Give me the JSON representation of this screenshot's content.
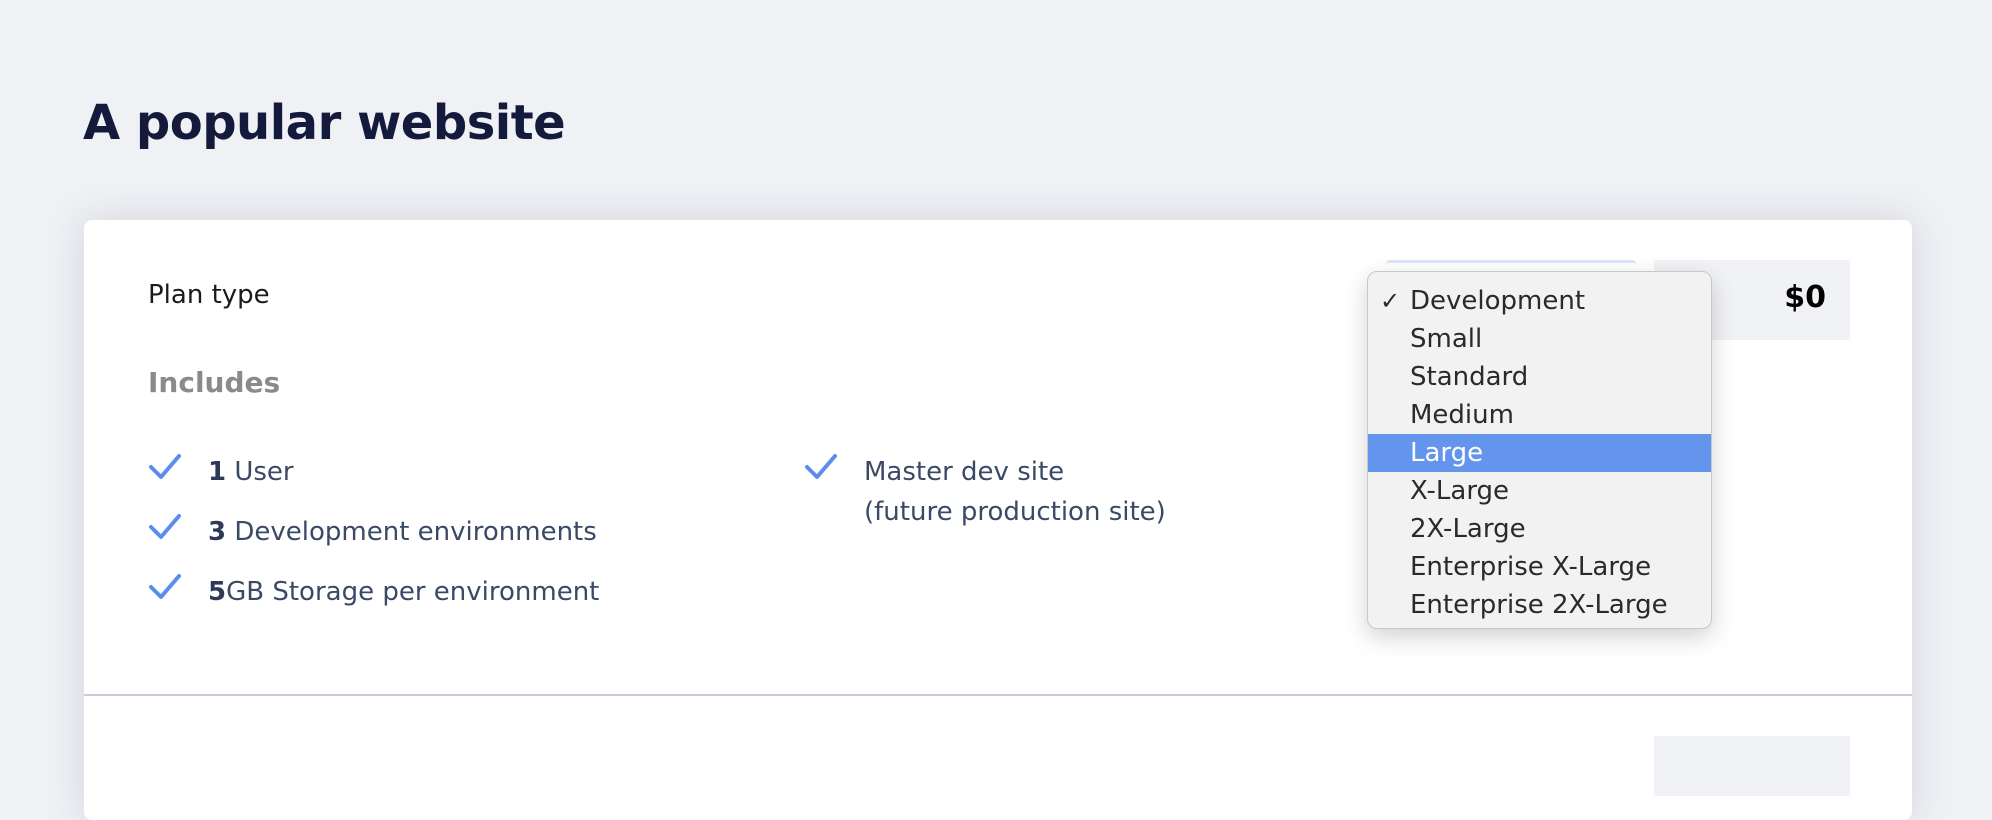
{
  "page": {
    "title": "A popular website"
  },
  "plan": {
    "label": "Plan type",
    "price": "$0"
  },
  "includes": {
    "heading": "Includes",
    "column1": [
      {
        "count": "1",
        "text": " User"
      },
      {
        "count": "3",
        "text": " Development environments"
      },
      {
        "count": "5",
        "text": "GB Storage per environment"
      }
    ],
    "column2": [
      {
        "line1": "Master dev site",
        "line2": "(future production site)"
      }
    ]
  },
  "dropdown": {
    "check_mark": "✓",
    "selected": "Development",
    "highlighted": "Large",
    "options": [
      "Development",
      "Small",
      "Standard",
      "Medium",
      "Large",
      "X-Large",
      "2X-Large",
      "Enterprise X-Large",
      "Enterprise 2X-Large"
    ]
  },
  "colors": {
    "accent": "#6495ed",
    "check": "#5b8def",
    "title": "#141a3c",
    "background": "#f0f1f5"
  },
  "icons": {
    "feature_check": "check-icon",
    "selected_option": "checkmark-icon"
  }
}
